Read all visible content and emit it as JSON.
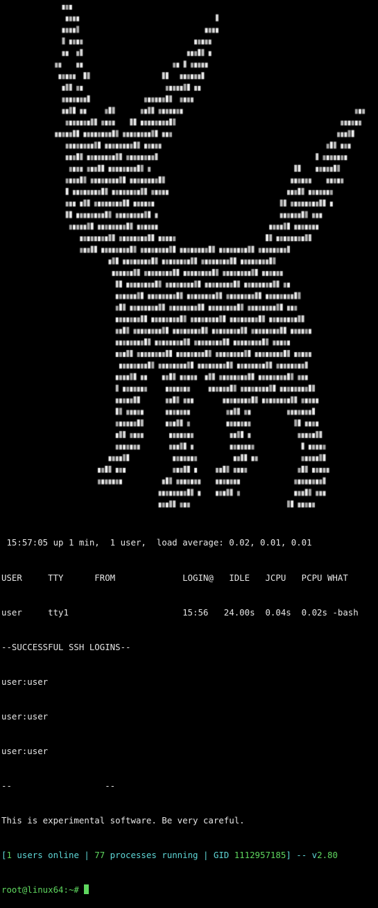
{
  "colors": {
    "background": "#000000",
    "text": "#e6e6e6",
    "cyan": "#5fd7d7",
    "green": "#5fd75f"
  },
  "terminal": {
    "uptime_line": " 15:57:05 up 1 min,  1 user,  load average: 0.02, 0.01, 0.01",
    "w_header": "USER     TTY      FROM             LOGIN@   IDLE   JCPU   PCPU WHAT",
    "w_row": "user     tty1                      15:56   24.00s  0.04s  0.02s -bash",
    "ssh_heading": "--SUCCESSFUL SSH LOGINS--",
    "ssh_logins": [
      "user:user",
      "user:user",
      "user:user"
    ],
    "separator": "--                  --",
    "warning": "This is experimental software. Be very careful.",
    "status": {
      "open_bracket": "[",
      "users_count": "1",
      "users_text": " users online | ",
      "procs_count": "77",
      "procs_text": " processes running | ",
      "gid_label": "GID ",
      "gid_value": "1112957185",
      "close_part": "] -- ",
      "version_prefix": "v",
      "version_number": "2.80"
    },
    "prompt": "root@linux64:~# "
  }
}
